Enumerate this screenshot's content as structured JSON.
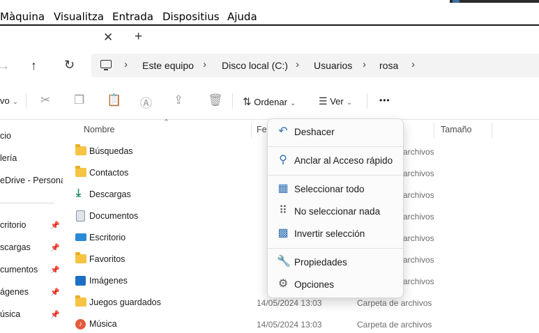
{
  "menubar": {
    "items": [
      "Màquina",
      "Visualitza",
      "Entrada",
      "Dispositius",
      "Ajuda"
    ]
  },
  "breadcrumb": [
    "Este equipo",
    "Disco local (C:)",
    "Usuarios",
    "rosa"
  ],
  "commandbar": {
    "new_label": "vo",
    "sort_label": "Ordenar",
    "view_label": "Ver",
    "more_label": "•••"
  },
  "sidebar": {
    "items": [
      {
        "label": "cio",
        "pinned": false
      },
      {
        "label": "lería",
        "pinned": false
      },
      {
        "label": "eDrive - Persona",
        "pinned": false
      },
      {
        "label": "critorio",
        "pinned": true
      },
      {
        "label": "scargas",
        "pinned": true
      },
      {
        "label": "cumentos",
        "pinned": true
      },
      {
        "label": "ágenes",
        "pinned": true
      },
      {
        "label": "úsica",
        "pinned": true
      }
    ]
  },
  "columns": {
    "name": "Nombre",
    "date": "Fec",
    "size": "Tamaño"
  },
  "files": [
    {
      "name": "Búsquedas",
      "icon": "folder-icon",
      "date": "",
      "type": "archivos"
    },
    {
      "name": "Contactos",
      "icon": "folder-icon",
      "date": "",
      "type": "archivos"
    },
    {
      "name": "Descargas",
      "icon": "download-icon",
      "date": "",
      "type": "archivos"
    },
    {
      "name": "Documentos",
      "icon": "document-icon",
      "date": "",
      "type": "archivos"
    },
    {
      "name": "Escritorio",
      "icon": "desktop-icon",
      "date": "",
      "type": "archivos"
    },
    {
      "name": "Favoritos",
      "icon": "folder-icon",
      "date": "",
      "type": "archivos"
    },
    {
      "name": "Imágenes",
      "icon": "images-icon",
      "date": "",
      "type": "archivos"
    },
    {
      "name": "Juegos guardados",
      "icon": "folder-icon",
      "date": "14/05/2024 13:03",
      "type": "Carpeta de archivos"
    },
    {
      "name": "Música",
      "icon": "music-icon",
      "date": "14/05/2024 13:03",
      "type": "Carpeta de archivos"
    }
  ],
  "context_menu": {
    "items": [
      {
        "label": "Deshacer",
        "icon": "undo-icon"
      },
      {
        "label": "Anclar al Acceso rápido",
        "icon": "pin-icon"
      },
      {
        "label": "Seleccionar todo",
        "icon": "select-all-icon"
      },
      {
        "label": "No seleccionar nada",
        "icon": "select-none-icon"
      },
      {
        "label": "Invertir selección",
        "icon": "invert-selection-icon"
      },
      {
        "label": "Propiedades",
        "icon": "wrench-icon"
      },
      {
        "label": "Opciones",
        "icon": "gear-icon"
      }
    ]
  },
  "colors": {
    "accent": "#2f6fb1",
    "folder": "#f6c343"
  }
}
